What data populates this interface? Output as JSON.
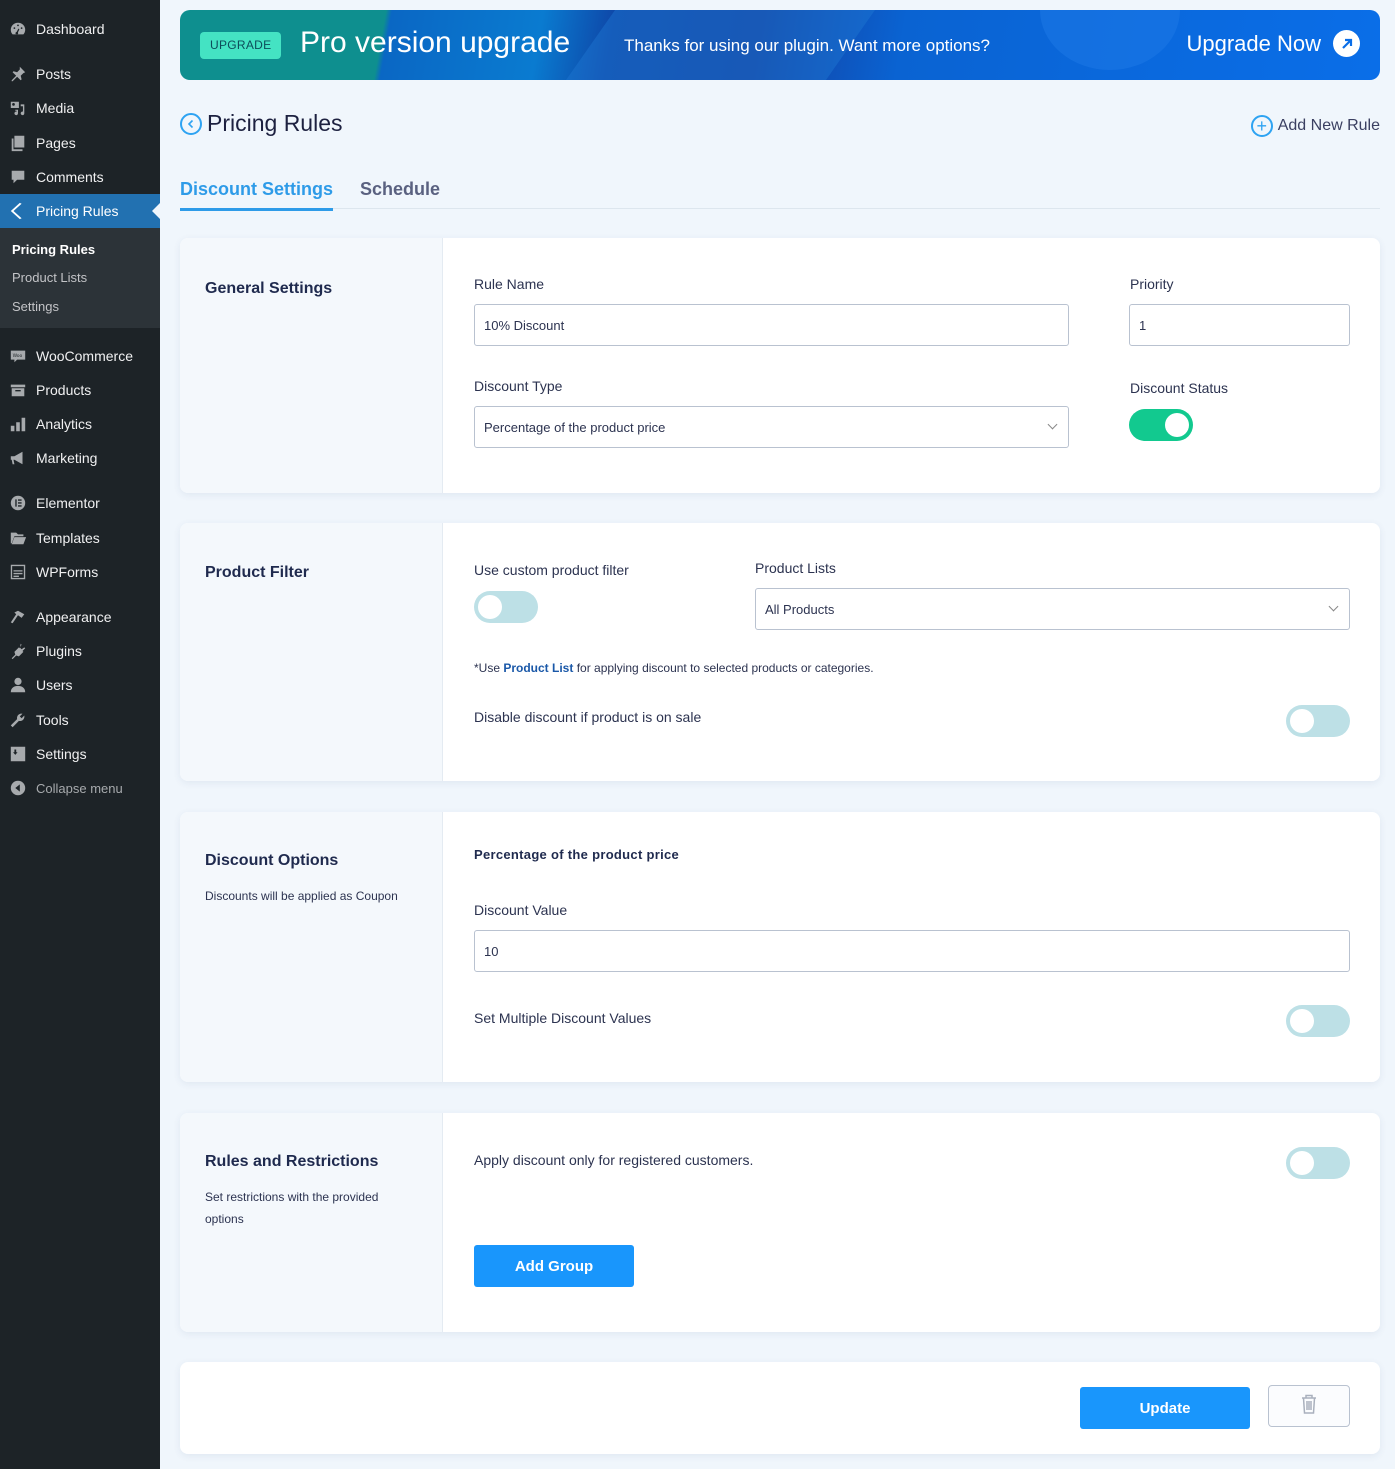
{
  "sidebar": {
    "items": [
      {
        "label": "Dashboard",
        "icon": "dashboard-icon"
      },
      {
        "label": "Posts",
        "icon": "pin-icon"
      },
      {
        "label": "Media",
        "icon": "media-icon"
      },
      {
        "label": "Pages",
        "icon": "pages-icon"
      },
      {
        "label": "Comments",
        "icon": "comment-icon"
      },
      {
        "label": "Pricing Rules",
        "icon": "chevron-left-icon",
        "active": true
      },
      {
        "label": "WooCommerce",
        "icon": "woo-icon"
      },
      {
        "label": "Products",
        "icon": "archive-icon"
      },
      {
        "label": "Analytics",
        "icon": "bar-chart-icon"
      },
      {
        "label": "Marketing",
        "icon": "megaphone-icon"
      },
      {
        "label": "Elementor",
        "icon": "elementor-icon"
      },
      {
        "label": "Templates",
        "icon": "folder-icon"
      },
      {
        "label": "WPForms",
        "icon": "form-icon"
      },
      {
        "label": "Appearance",
        "icon": "paintbrush-icon"
      },
      {
        "label": "Plugins",
        "icon": "plug-icon"
      },
      {
        "label": "Users",
        "icon": "user-icon"
      },
      {
        "label": "Tools",
        "icon": "wrench-icon"
      },
      {
        "label": "Settings",
        "icon": "sliders-icon"
      }
    ],
    "submenu": [
      "Pricing Rules",
      "Product Lists",
      "Settings"
    ],
    "collapse_label": "Collapse menu"
  },
  "banner": {
    "badge": "UPGRADE",
    "title": "Pro version upgrade",
    "message": "Thanks for using our plugin. Want more options?",
    "cta": "Upgrade Now"
  },
  "header": {
    "title": "Pricing Rules",
    "add_new": "Add New Rule"
  },
  "tabs": [
    {
      "label": "Discount Settings",
      "active": true
    },
    {
      "label": "Schedule",
      "active": false
    }
  ],
  "general": {
    "title": "General Settings",
    "rule_name_label": "Rule Name",
    "rule_name_value": "10% Discount",
    "priority_label": "Priority",
    "priority_value": "1",
    "discount_type_label": "Discount Type",
    "discount_type_value": "Percentage of the product price",
    "status_label": "Discount Status",
    "status_on": true
  },
  "product_filter": {
    "title": "Product Filter",
    "custom_filter_label": "Use custom product filter",
    "custom_filter_on": false,
    "product_lists_label": "Product Lists",
    "product_lists_value": "All Products",
    "hint_prefix": "*Use ",
    "hint_link": "Product List",
    "hint_suffix": " for applying discount to selected products or categories.",
    "disable_on_sale_label": "Disable discount if product is on sale",
    "disable_on_sale_on": false
  },
  "discount_options": {
    "title": "Discount Options",
    "description": "Discounts will be applied as Coupon",
    "subheading": "Percentage of the product price",
    "value_label": "Discount Value",
    "value": "10",
    "multiple_label": "Set Multiple Discount Values",
    "multiple_on": false
  },
  "rules": {
    "title": "Rules and Restrictions",
    "description": "Set restrictions with the provided options",
    "registered_label": "Apply discount only for registered customers.",
    "registered_on": false,
    "add_group": "Add Group"
  },
  "footer": {
    "update": "Update"
  }
}
